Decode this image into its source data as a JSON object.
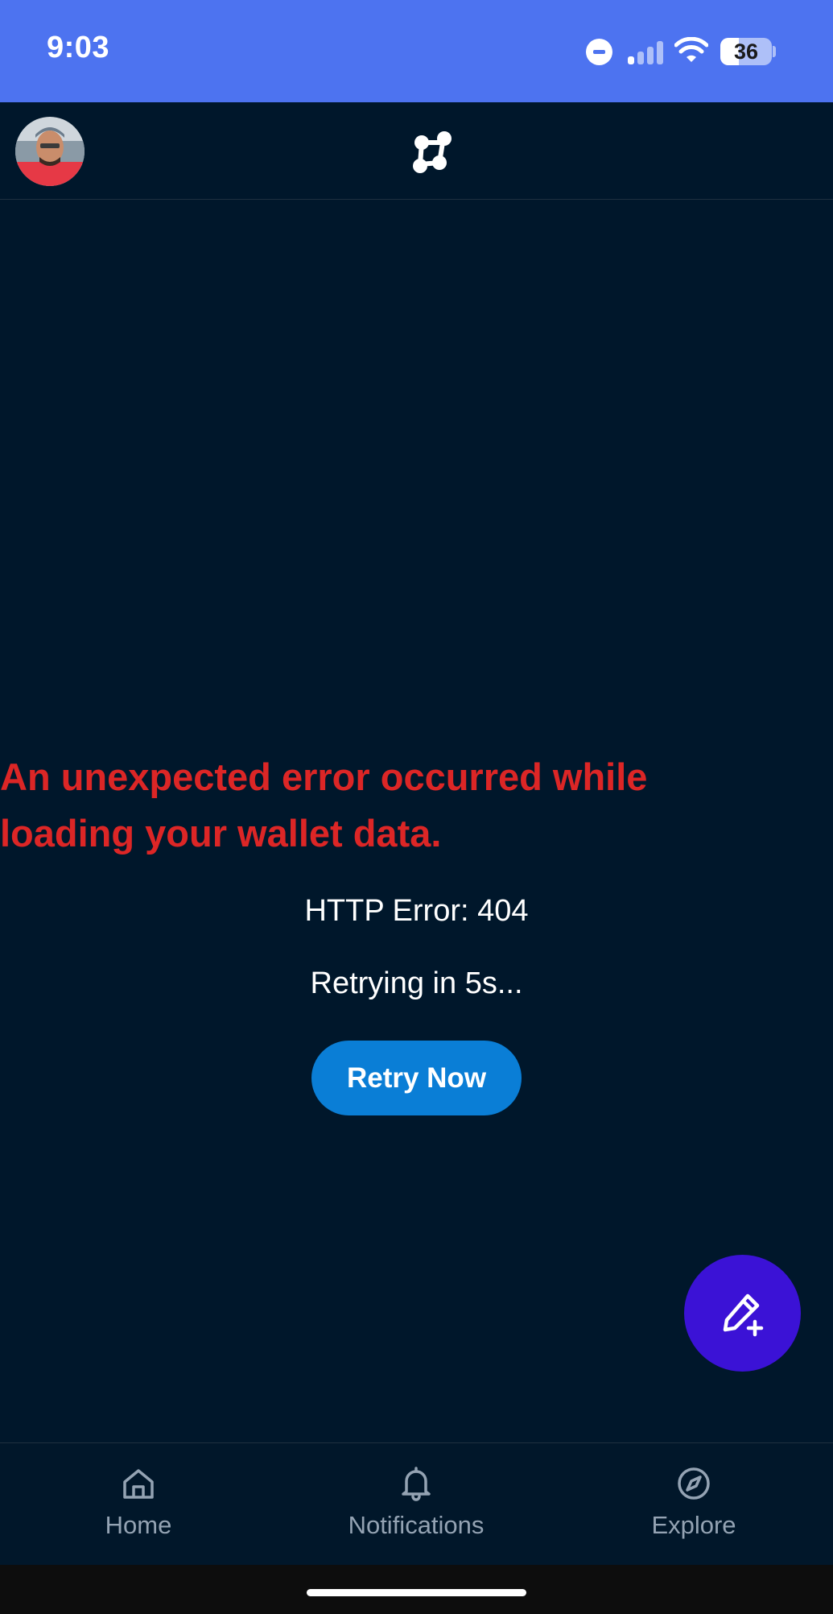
{
  "status_bar": {
    "time": "9:03",
    "battery_level": "36",
    "battery_fraction": 0.36,
    "icons": [
      "do-not-disturb-icon",
      "cellular-signal-icon",
      "wifi-icon",
      "battery-icon"
    ],
    "background_color": "#4d73f0"
  },
  "header": {
    "avatar_icon": "user-avatar",
    "logo_icon": "network-nodes-logo"
  },
  "error": {
    "message": "An unexpected error occurred while loading your wallet data.",
    "code_text": "HTTP Error: 404",
    "retry_status": "Retrying in 5s...",
    "retry_button_label": "Retry Now",
    "message_color": "#dc2626",
    "button_color": "#0a7ed6"
  },
  "fab": {
    "icon": "compose-pencil-plus-icon",
    "color": "#3b12d6"
  },
  "bottom_nav": {
    "items": [
      {
        "label": "Home",
        "icon": "home-icon"
      },
      {
        "label": "Notifications",
        "icon": "bell-icon"
      },
      {
        "label": "Explore",
        "icon": "compass-icon"
      }
    ]
  },
  "colors": {
    "background": "#00172b",
    "nav_label": "#94a3b3"
  }
}
